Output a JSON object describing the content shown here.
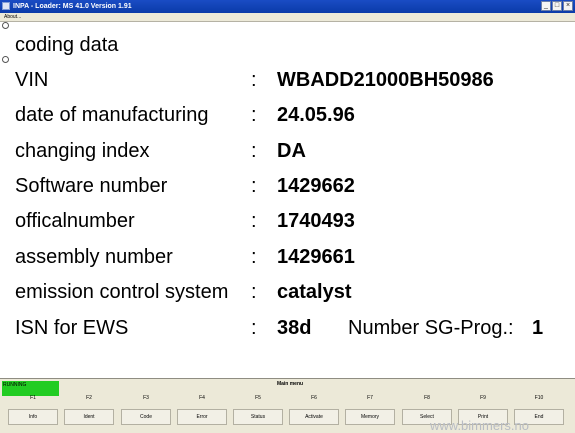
{
  "window": {
    "title": "INPA - Loader:  MS 41.0 Version 1.91",
    "minimize_glyph": "_",
    "maximize_glyph": "□",
    "close_glyph": "×"
  },
  "menubar": {
    "about_label": "About..."
  },
  "rows": [
    {
      "label": "coding data",
      "value": ""
    },
    {
      "label": "VIN",
      "colon": ":",
      "value": "WBADD21000BH50986"
    },
    {
      "label": "date of manufacturing",
      "colon": ":",
      "value": "24.05.96"
    },
    {
      "label": "changing index",
      "colon": ":",
      "value": "DA"
    },
    {
      "label": "Software number",
      "colon": ":",
      "value": "1429662"
    },
    {
      "label": "officalnumber",
      "colon": ":",
      "value": "1740493"
    },
    {
      "label": "assembly number",
      "colon": ":",
      "value": "1429661"
    },
    {
      "label": "emission control system",
      "colon": ":",
      "value": "catalyst"
    },
    {
      "label": "ISN for EWS",
      "colon": ":",
      "value": "38d",
      "extra_label": "Number SG-Prog.:",
      "extra_value": "1"
    }
  ],
  "status": {
    "running_label": "RUNNING",
    "running_color": "#22cc22",
    "menu_title": "Main menu"
  },
  "function_keys": [
    {
      "key": "F1",
      "label": "Info"
    },
    {
      "key": "F2",
      "label": "Ident"
    },
    {
      "key": "F3",
      "label": "Code"
    },
    {
      "key": "F4",
      "label": "Error"
    },
    {
      "key": "F5",
      "label": "Status"
    },
    {
      "key": "F6",
      "label": "Activate"
    },
    {
      "key": "F7",
      "label": "Memory"
    },
    {
      "key": "F8",
      "label": "Select"
    },
    {
      "key": "F9",
      "label": "Print"
    },
    {
      "key": "F10",
      "label": "End"
    }
  ],
  "watermark": "www.bimmers.no"
}
